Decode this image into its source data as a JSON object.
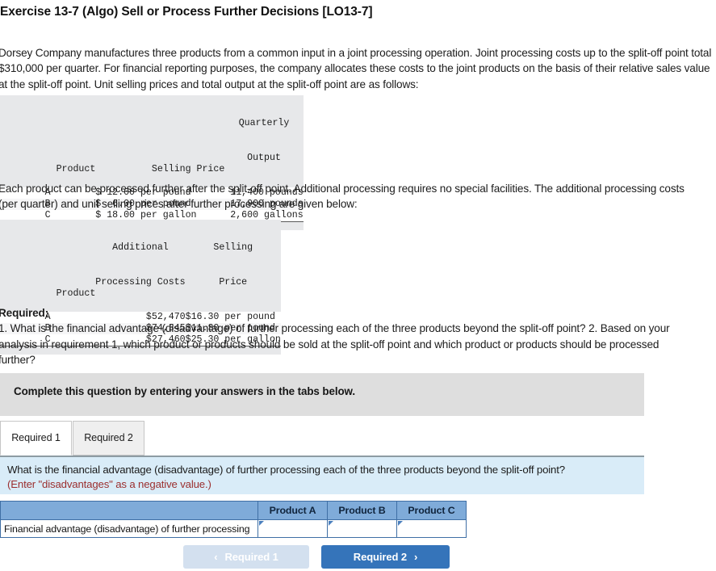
{
  "exercise": {
    "title": "Exercise 13-7 (Algo) Sell or Process Further Decisions [LO13-7]"
  },
  "intro": {
    "paragraph_1": "Dorsey Company manufactures three products from a common input in a joint processing operation. Joint processing costs up to the split-off point total $310,000 per quarter. For financial reporting purposes, the company allocates these costs to the joint products on the basis of their relative sales value at the split-off point. Unit selling prices and total output at the split-off point are as follows:",
    "paragraph_2": "Each product can be processed further after the split-off point. Additional processing requires no special facilities. The additional processing costs (per quarter) and unit selling prices after further processing are given below:"
  },
  "table_splitoff": {
    "headers": {
      "product": "Product",
      "selling_price": "Selling Price",
      "quarterly": "Quarterly",
      "output": "Output"
    },
    "rows": [
      {
        "product": "A",
        "selling_price": "$ 12.00 per pound",
        "output": "11,400 pounds"
      },
      {
        "product": "B",
        "selling_price": "$  6.00 per pound",
        "output": "17,900 pounds"
      },
      {
        "product": "C",
        "selling_price": "$ 18.00 per gallon",
        "output": " 2,600 gallons"
      }
    ]
  },
  "table_further": {
    "headers": {
      "product": "Product",
      "additional": "Additional",
      "processing_costs": "Processing Costs",
      "selling": "Selling",
      "price": "Price"
    },
    "rows": [
      {
        "product": "A",
        "cost": "$52,470",
        "price": "$16.30 per pound"
      },
      {
        "product": "B",
        "cost": "$74,345",
        "price": "$11.30 per pound"
      },
      {
        "product": "C",
        "cost": "$27,460",
        "price": "$25.30 per gallon"
      }
    ]
  },
  "required": {
    "label": "Required:",
    "item_1": "1. What is the financial advantage (disadvantage) of further processing each of the three products beyond the split-off point?",
    "item_2": "2. Based on your analysis in requirement 1, which product or products should be sold at the split-off point and which product or products should be processed further?"
  },
  "banner": {
    "text": "Complete this question by entering your answers in the tabs below."
  },
  "tabs": [
    {
      "label": "Required 1",
      "active": true
    },
    {
      "label": "Required 2",
      "active": false
    }
  ],
  "question_panel": {
    "line_1": "What is the financial advantage (disadvantage) of further processing each of the three products beyond the split-off point?",
    "line_2": "(Enter \"disadvantages\" as a negative value.)"
  },
  "answer_table": {
    "column_headers": [
      "",
      "Product A",
      "Product B",
      "Product C"
    ],
    "row_label": "Financial advantage (disadvantage) of further processing",
    "values": [
      "",
      "",
      ""
    ]
  },
  "navigation": {
    "prev_label": "Required 1",
    "prev_icon": "chevron-left-icon",
    "next_label": "Required 2",
    "next_icon": "chevron-right-icon",
    "prev_chevron": "‹",
    "next_chevron": "›"
  },
  "colors": {
    "accent_blue": "#3574ba",
    "table_header_blue": "#7fabd9",
    "panel_blue": "#d9ecf8",
    "banner_gray": "#dedede",
    "warning_red": "#9b2f2f"
  }
}
